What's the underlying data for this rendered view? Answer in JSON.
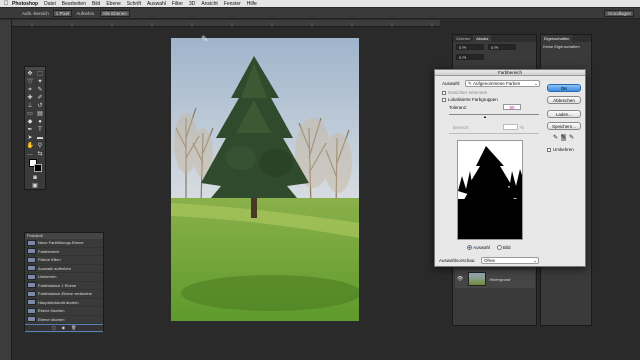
{
  "menubar": {
    "app": "Photoshop",
    "items": [
      "Datei",
      "Bearbeiten",
      "Bild",
      "Ebene",
      "Schrift",
      "Auswahl",
      "Filter",
      "3D",
      "Ansicht",
      "Fenster",
      "Hilfe"
    ],
    "workspace": "Grundlagen"
  },
  "options": {
    "size_label": "Aufn.-bereich",
    "size_value": "1 Pixel",
    "sample_label": "Aufnehm.",
    "sample_value": "Alle Ebenen",
    "workspace_value": "Grundlagen"
  },
  "history": {
    "title": "Protokoll",
    "items": [
      "Neue Farbfüllungs-Ebene",
      "Farbbereich",
      "Fläche füllen",
      "Auswahl aufheben",
      "Umkehren",
      "Farbbalance 1 Ebene",
      "Farbbalance-Ebene verändern",
      "Hauptdeckkraft ändern",
      "Ebene löschen",
      "Ebene löschen",
      "Neue Farbfüllungs-Ebene"
    ],
    "active_index": 10
  },
  "panels": {
    "mid_tabs": [
      "Zeichen",
      "Absatz"
    ],
    "right_tab": "Eigenschaften",
    "right_text": "Keine Eigenschaften",
    "pt1": "0 Pt",
    "pt2": "0 Pt",
    "pt3": "0 Pt",
    "layer_name": "Hintergrund"
  },
  "dialog": {
    "title": "Farbbereich",
    "auswahl_label": "Auswahl:",
    "auswahl_value": "Aufgenommene Farben",
    "gesichter": "Gesichter erkennen",
    "lokal": "Lokalisierte Farbgruppen",
    "toleranz_label": "Toleranz:",
    "toleranz_value": "50",
    "bereich_label": "Bereich:",
    "bereich_unit": "%",
    "ok": "OK",
    "cancel": "Abbrechen",
    "load": "Laden...",
    "save": "Speichern...",
    "invert": "Umkehren",
    "radio_selection": "Auswahl",
    "radio_image": "Bild",
    "preview_label": "Auswahlvorschau:",
    "preview_value": "Ohne"
  }
}
